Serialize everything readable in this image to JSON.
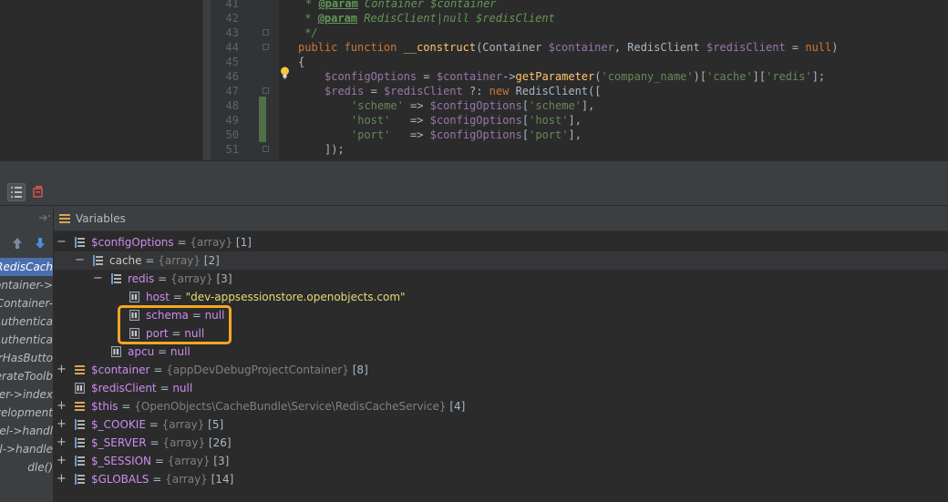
{
  "editor": {
    "lines": [
      {
        "no": "41"
      },
      {
        "no": "42"
      },
      {
        "no": "43"
      },
      {
        "no": "44"
      },
      {
        "no": "45"
      },
      {
        "no": "46"
      },
      {
        "no": "47"
      },
      {
        "no": "48"
      },
      {
        "no": "49"
      },
      {
        "no": "50"
      },
      {
        "no": "51"
      }
    ],
    "code": {
      "l41_star": "* ",
      "l41_tag": "@param",
      "l41_rest": " Container $container",
      "l42_star": " * ",
      "l42_tag": "@param",
      "l42_rest": " RedisClient|null $redisClient",
      "l43": " */",
      "l44_kw": "public function ",
      "l44_fn": "__construct",
      "l44_p1": "(Container ",
      "l44_v1": "$container",
      "l44_p2": ", RedisClient ",
      "l44_v2": "$redisClient",
      "l44_p3": " = ",
      "l44_null": "null",
      "l44_p4": ")",
      "l45": "{",
      "l46_v1": "$configOptions",
      "l46_p1": " = ",
      "l46_v2": "$container",
      "l46_p2": "->",
      "l46_fn": "getParameter",
      "l46_p3": "(",
      "l46_s1": "'company_name'",
      "l46_p4": ")[",
      "l46_s2": "'cache'",
      "l46_p5": "][",
      "l46_s3": "'redis'",
      "l46_p6": "];",
      "l47_v1": "$redis",
      "l47_p1": " = ",
      "l47_v2": "$redisClient",
      "l47_p2": " ?: ",
      "l47_kw": "new ",
      "l47_p3": "RedisClient([",
      "l48_s1": "'scheme'",
      "l48_p1": " => ",
      "l48_v": "$configOptions",
      "l48_p2": "[",
      "l48_s2": "'scheme'",
      "l48_p3": "],",
      "l49_s1": "'host'",
      "l49_p1": "   => ",
      "l49_v": "$configOptions",
      "l49_p2": "[",
      "l49_s2": "'host'",
      "l49_p3": "],",
      "l50_s1": "'port'",
      "l50_p1": "   => ",
      "l50_v": "$configOptions",
      "l50_p2": "[",
      "l50_s2": "'port'",
      "l50_p3": "],",
      "l51": "]);"
    }
  },
  "frames": {
    "items": [
      {
        "label": "RedisCach"
      },
      {
        "label": "Container->"
      },
      {
        "label": "\\Container-"
      },
      {
        "label": "tAuthentica"
      },
      {
        "label": "tAuthentica"
      },
      {
        "label": "erHasButto"
      },
      {
        "label": "nerateToolb"
      },
      {
        "label": "oller->index"
      },
      {
        "label": "evelopment"
      },
      {
        "label": "nel->handl"
      },
      {
        "label": "el->handle"
      },
      {
        "label": "dle()"
      }
    ]
  },
  "variables": {
    "title": "Variables",
    "rows": [
      {
        "name": "$configOptions",
        "eq": " = ",
        "type": "{array}",
        "count": " [1]"
      },
      {
        "name": "cache",
        "eq": " = ",
        "type": "{array}",
        "count": " [2]"
      },
      {
        "name": "redis",
        "eq": " = ",
        "type": "{array}",
        "count": " [3]"
      },
      {
        "name": "host",
        "eq": " = ",
        "value": "\"dev-appsessionstore.openobjects.com\""
      },
      {
        "name": "schema",
        "eq": " = ",
        "value": "null"
      },
      {
        "name": "port",
        "eq": " = ",
        "value": "null"
      },
      {
        "name": "apcu",
        "eq": " = ",
        "value": "null"
      },
      {
        "name": "$container",
        "eq": " = ",
        "type": "{appDevDebugProjectContainer}",
        "count": " [8]"
      },
      {
        "name": "$redisClient",
        "eq": " = ",
        "value": "null"
      },
      {
        "name": "$this",
        "eq": " = ",
        "type": "{OpenObjects\\CacheBundle\\Service\\RedisCacheService}",
        "count": " [4]"
      },
      {
        "name": "$_COOKIE",
        "eq": " = ",
        "type": "{array}",
        "count": " [5]"
      },
      {
        "name": "$_SERVER",
        "eq": " = ",
        "type": "{array}",
        "count": " [26]"
      },
      {
        "name": "$_SESSION",
        "eq": " = ",
        "type": "{array}",
        "count": " [3]"
      },
      {
        "name": "$GLOBALS",
        "eq": " = ",
        "type": "{array}",
        "count": " [14]"
      }
    ]
  },
  "colors": {
    "highlight": "#f5a623",
    "selected_frame": "#4b6eaf"
  }
}
